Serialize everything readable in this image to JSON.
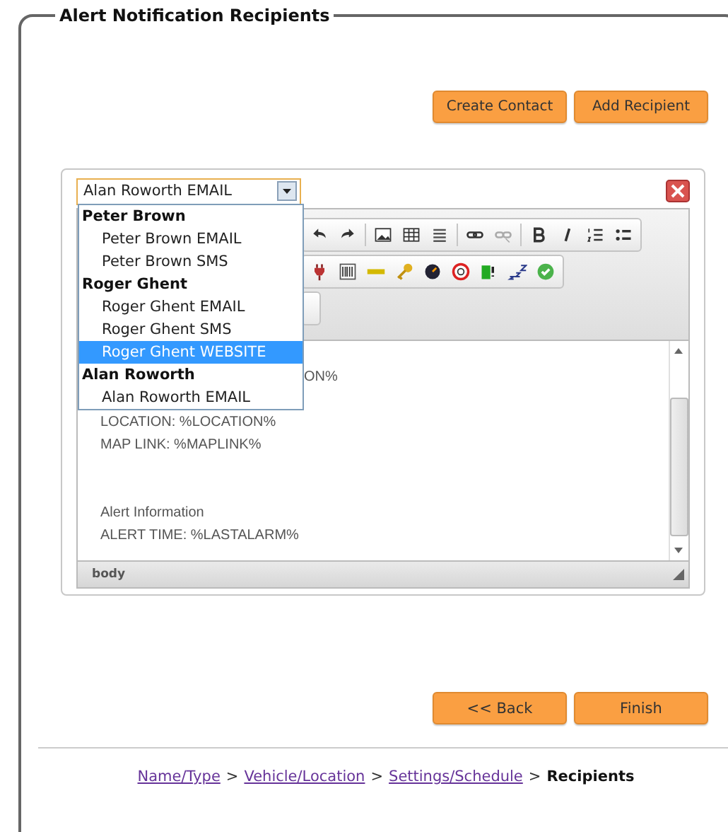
{
  "legend": "Alert Notification Recipients",
  "top_buttons": [
    "Create Contact",
    "Add Recipient"
  ],
  "recipient_select": {
    "value": "Alan Roworth EMAIL",
    "open": true
  },
  "dropdown_options": [
    {
      "kind": "group",
      "label": "Peter Brown",
      "selected": false
    },
    {
      "kind": "option",
      "label": "Peter Brown EMAIL",
      "selected": false
    },
    {
      "kind": "option",
      "label": "Peter Brown SMS",
      "selected": false
    },
    {
      "kind": "group",
      "label": "Roger Ghent",
      "selected": false
    },
    {
      "kind": "option",
      "label": "Roger Ghent EMAIL",
      "selected": false
    },
    {
      "kind": "option",
      "label": "Roger Ghent SMS",
      "selected": false
    },
    {
      "kind": "option",
      "label": "Roger Ghent WEBSITE",
      "selected": true
    },
    {
      "kind": "group",
      "label": "Alan Roworth",
      "selected": false
    },
    {
      "kind": "option",
      "label": "Alan Roworth EMAIL",
      "selected": false
    }
  ],
  "editor": {
    "content_lines": [
      {
        "kind": "tail",
        "text": "ON%"
      },
      {
        "kind": "blank"
      },
      {
        "kind": "text",
        "text": "LOCATION: %LOCATION%"
      },
      {
        "kind": "text",
        "text": "MAP LINK: %MAPLINK%"
      },
      {
        "kind": "blank"
      },
      {
        "kind": "blank"
      },
      {
        "kind": "text",
        "text": "Alert Information"
      },
      {
        "kind": "text",
        "text": "ALERT TIME: %LASTALARM%"
      }
    ],
    "status_path": "body"
  },
  "nav_buttons": [
    "<< Back",
    "Finish"
  ],
  "breadcrumb_separator": ">",
  "breadcrumb": [
    {
      "label": "Name/Type",
      "current": false
    },
    {
      "label": "Vehicle/Location",
      "current": false
    },
    {
      "label": "Settings/Schedule",
      "current": false
    },
    {
      "label": "Recipients",
      "current": true
    }
  ]
}
